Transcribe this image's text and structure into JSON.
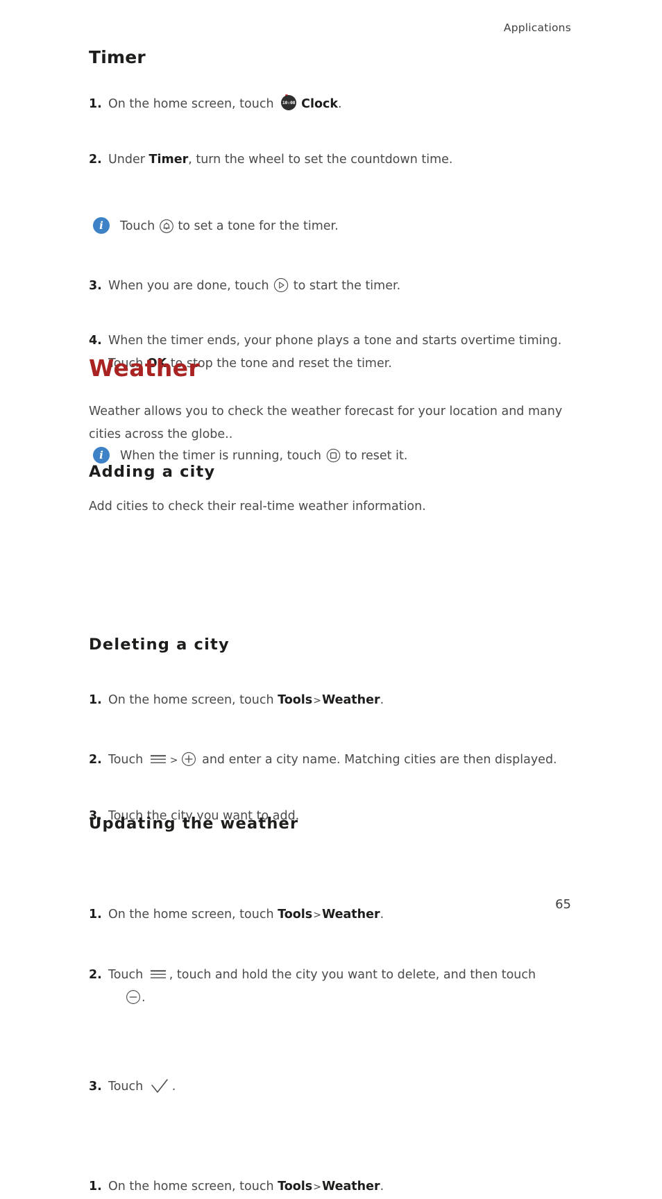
{
  "header": {
    "running_head": "Applications"
  },
  "footer": {
    "page_number": "65"
  },
  "colors": {
    "chapter_title": "#a82321",
    "section_title": "#1d1d1b",
    "body_text": "#4a4a4a",
    "note_badge": "#3d82c7",
    "clock_icon_dot": "#d83030"
  },
  "timer_section": {
    "title": "Timer",
    "steps": [
      {
        "num": "1.",
        "parts": [
          {
            "type": "text",
            "value": "On the home screen, touch "
          },
          {
            "type": "icon",
            "name": "clock-app-icon",
            "label": "10:08"
          },
          {
            "type": "bold",
            "value": "Clock"
          },
          {
            "type": "text",
            "value": "."
          }
        ]
      },
      {
        "num": "2.",
        "parts": [
          {
            "type": "text",
            "value": "Under "
          },
          {
            "type": "bold",
            "value": "Timer"
          },
          {
            "type": "text",
            "value": ", turn the wheel to set the countdown time."
          }
        ]
      }
    ],
    "note_1": {
      "icon": "info-icon",
      "badge_letter": "i",
      "parts": [
        {
          "type": "text",
          "value": "Touch "
        },
        {
          "type": "icon",
          "name": "bell-tone-icon"
        },
        {
          "type": "text",
          "value": " to set a tone for the timer."
        }
      ]
    },
    "steps_cont": [
      {
        "num": "3.",
        "parts": [
          {
            "type": "text",
            "value": "When you are done, touch "
          },
          {
            "type": "icon",
            "name": "play-start-icon"
          },
          {
            "type": "text",
            "value": " to start the timer."
          }
        ]
      },
      {
        "num": "4.",
        "parts": [
          {
            "type": "text",
            "value": "When the timer ends, your phone plays a tone and starts overtime timing. Touch "
          },
          {
            "type": "bold",
            "value": "OK"
          },
          {
            "type": "text",
            "value": " to stop the tone and reset the timer."
          }
        ]
      }
    ],
    "note_2": {
      "icon": "info-icon",
      "badge_letter": "i",
      "parts": [
        {
          "type": "text",
          "value": "When the timer is running, touch "
        },
        {
          "type": "icon",
          "name": "stop-reset-icon"
        },
        {
          "type": "text",
          "value": " to reset it."
        }
      ]
    }
  },
  "weather_section": {
    "title": "Weather",
    "intro": "Weather allows you to check the weather forecast for your location and many cities across the globe..",
    "adding_a_city": {
      "title": "Adding  a  city",
      "lead": "Add cities to check their real-time weather information.",
      "steps": [
        {
          "num": "1.",
          "parts": [
            {
              "type": "text",
              "value": "On the home screen, touch "
            },
            {
              "type": "bold",
              "value": "Tools"
            },
            {
              "type": "sep",
              "value": ">"
            },
            {
              "type": "bold",
              "value": "Weather"
            },
            {
              "type": "text",
              "value": "."
            }
          ]
        },
        {
          "num": "2.",
          "parts": [
            {
              "type": "text",
              "value": "Touch "
            },
            {
              "type": "icon",
              "name": "hamburger-menu-icon"
            },
            {
              "type": "sep",
              "value": ">"
            },
            {
              "type": "icon",
              "name": "plus-circle-icon"
            },
            {
              "type": "text",
              "value": " and enter a city name. Matching cities are then displayed."
            }
          ]
        },
        {
          "num": "3.",
          "parts": [
            {
              "type": "text",
              "value": "Touch the city you want to add."
            }
          ]
        }
      ]
    },
    "deleting_a_city": {
      "title": "Deleting  a  city",
      "steps": [
        {
          "num": "1.",
          "parts": [
            {
              "type": "text",
              "value": "On the home screen, touch "
            },
            {
              "type": "bold",
              "value": "Tools"
            },
            {
              "type": "sep",
              "value": ">"
            },
            {
              "type": "bold",
              "value": "Weather"
            },
            {
              "type": "text",
              "value": "."
            }
          ]
        },
        {
          "num": "2.",
          "parts": [
            {
              "type": "text",
              "value": "Touch "
            },
            {
              "type": "icon",
              "name": "hamburger-menu-icon"
            },
            {
              "type": "text",
              "value": ", touch and hold the city you want to delete, and then touch "
            },
            {
              "type": "icon",
              "name": "minus-circle-icon"
            },
            {
              "type": "text",
              "value": "."
            }
          ]
        },
        {
          "num": "3.",
          "parts": [
            {
              "type": "text",
              "value": "Touch "
            },
            {
              "type": "icon",
              "name": "checkmark-icon"
            },
            {
              "type": "text",
              "value": "."
            }
          ]
        }
      ]
    },
    "updating_the_weather": {
      "title": "Updating  the  weather",
      "steps": [
        {
          "num": "1.",
          "parts": [
            {
              "type": "text",
              "value": "On the home screen, touch "
            },
            {
              "type": "bold",
              "value": "Tools"
            },
            {
              "type": "sep",
              "value": ">"
            },
            {
              "type": "bold",
              "value": "Weather"
            },
            {
              "type": "text",
              "value": "."
            }
          ]
        }
      ]
    }
  },
  "labels": {
    "step1_prefix": "On the home screen, touch ",
    "clock_word": "Clock",
    "period": ".",
    "under": "Under ",
    "timer_word": "Timer",
    "step2_rest": ", turn the wheel to set the countdown time.",
    "note1_touch": "Touch ",
    "note1_rest": " to set a tone for the timer.",
    "step3_pre": "When you are done, touch ",
    "step3_rest": " to start the timer.",
    "step4_pre": "When the timer ends, your phone plays a tone and starts overtime timing. Touch ",
    "ok_word": "OK",
    "step4_rest": " to stop the tone and reset the timer.",
    "note2_pre": "When the timer is running, touch ",
    "note2_rest": " to reset it.",
    "tools_word": "Tools",
    "weather_word": "Weather",
    "gt": ">",
    "touch_word": "Touch ",
    "add_step2_rest": " and enter a city name. Matching cities are then displayed.",
    "add_step3": "Touch the city you want to add.",
    "del_step2_mid": ", touch and hold the city you want to delete, and then touch ",
    "clock_digits": "10:08"
  }
}
